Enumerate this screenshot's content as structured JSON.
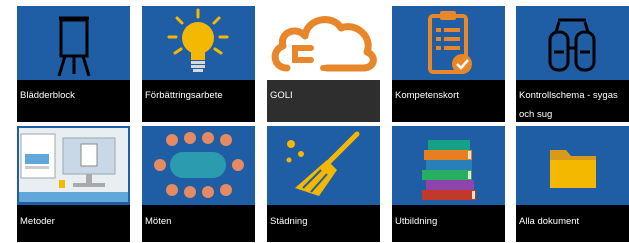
{
  "colors": {
    "tile_blue": "#1f5ea5",
    "tile_dark": "#000000",
    "goli_gray": "#2e2e2e",
    "label_text": "#ffffff",
    "accent_yellow": "#f5b800",
    "accent_orange": "#e8862a"
  },
  "tiles": [
    {
      "label": "Blädderblock",
      "icon": "flipchart-icon"
    },
    {
      "label": "Förbättringsarbete",
      "icon": "lightbulb-icon"
    },
    {
      "label": "GOLI",
      "icon": "goli-cloud-logo"
    },
    {
      "label": "Kompetenskort",
      "icon": "clipboard-check-icon"
    },
    {
      "label": "Kontrollschema - sygas och sug",
      "icon": "gas-cylinders-icon"
    },
    {
      "label": "Metoder",
      "icon": "computer-documents-icon"
    },
    {
      "label": "Möten",
      "icon": "meeting-table-icon"
    },
    {
      "label": "Städning",
      "icon": "broom-icon"
    },
    {
      "label": "Utbildning",
      "icon": "books-icon"
    },
    {
      "label": "Alla dokument",
      "icon": "folder-icon"
    }
  ]
}
